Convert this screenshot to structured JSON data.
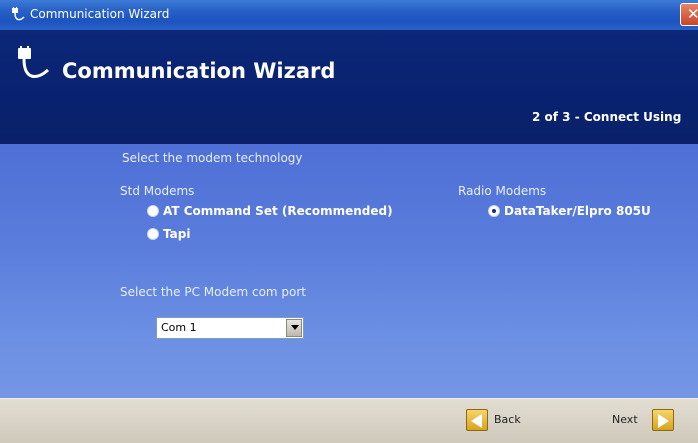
{
  "window": {
    "title": "Communication Wizard",
    "icons": {
      "app": "plug-cable-icon",
      "close": "close-icon"
    }
  },
  "header": {
    "title": "Communication Wizard",
    "step": "2 of 3 - Connect Using",
    "icon": "plug-cable-icon"
  },
  "form": {
    "instruction": "Select the modem technology",
    "std_modems_label": "Std Modems",
    "radio_modems_label": "Radio Modems",
    "options": [
      {
        "label": "AT Command Set (Recommended)",
        "checked": false
      },
      {
        "label": "Tapi",
        "checked": false
      },
      {
        "label": "DataTaker/Elpro 805U",
        "checked": true
      }
    ],
    "port_label": "Select the PC Modem com port",
    "port_value": "Com 1"
  },
  "footer": {
    "back_label": "Back",
    "next_label": "Next"
  },
  "colors": {
    "title_bar": "#2761c8",
    "header": "#0b2777",
    "body_top": "#4e6fd6",
    "body_bottom": "#7596e4",
    "footer": "#d9d4c8"
  }
}
